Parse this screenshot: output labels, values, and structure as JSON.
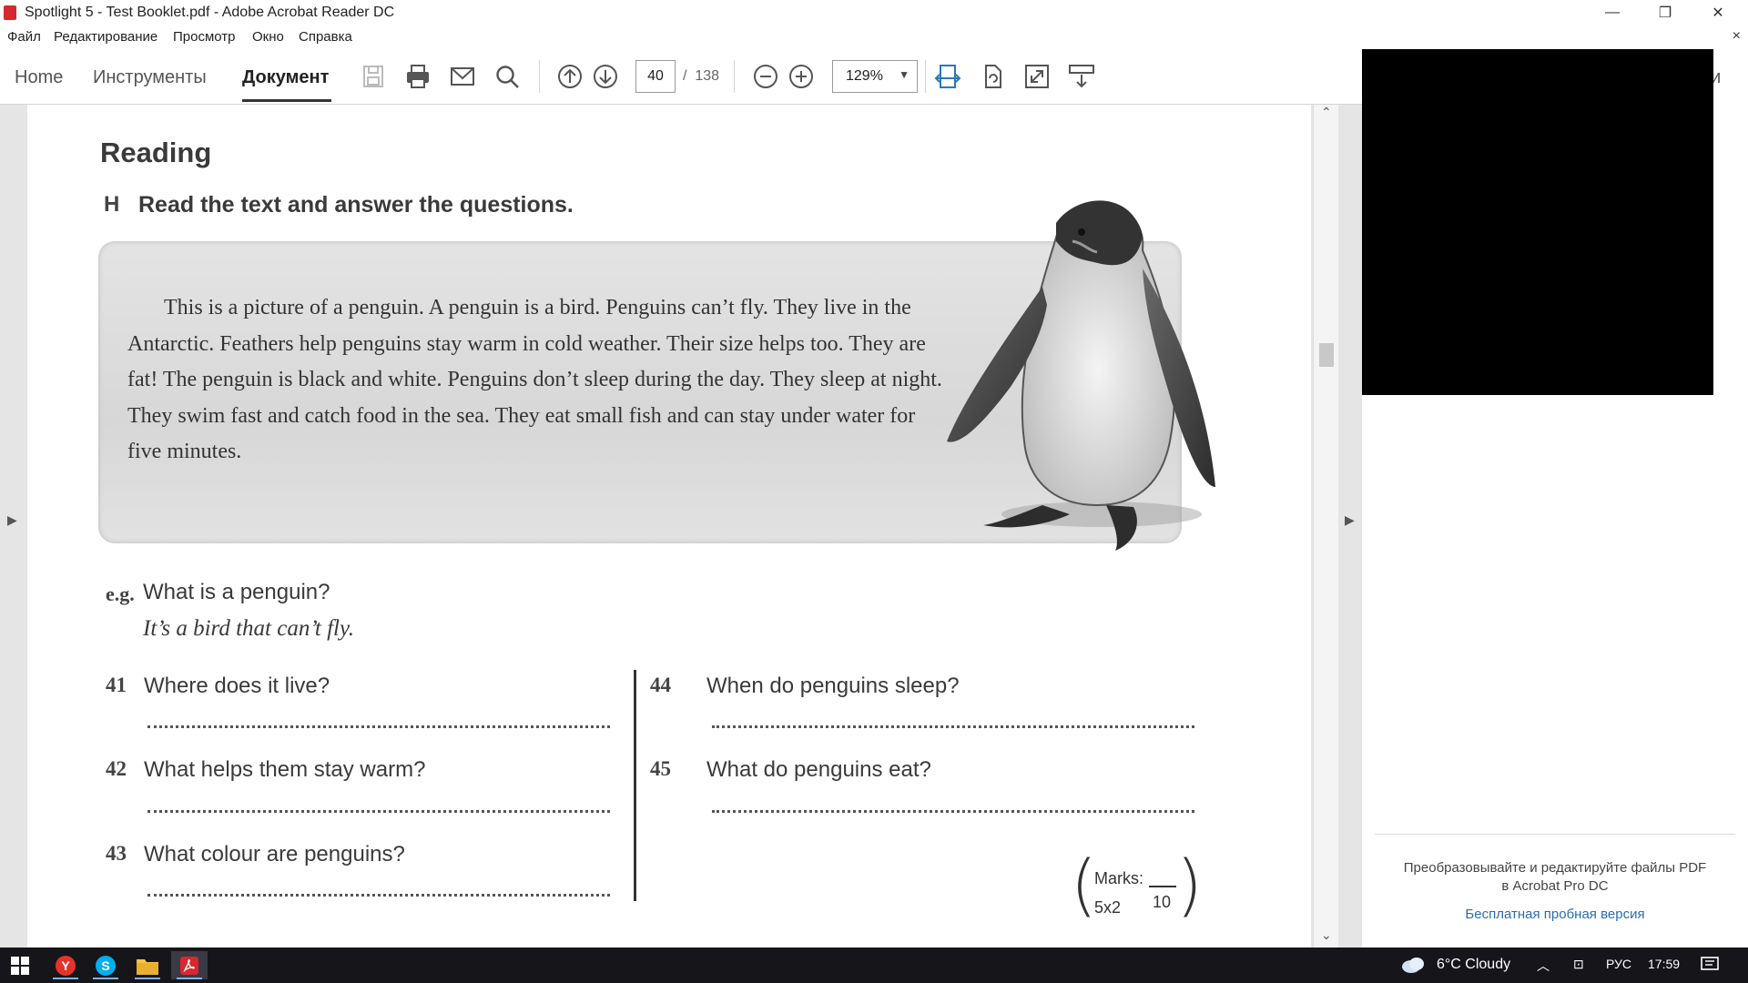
{
  "window": {
    "title": "Spotlight 5 - Test Booklet.pdf - Adobe Acrobat Reader DC",
    "minimize": "—",
    "maximize": "❐",
    "close": "✕"
  },
  "menu": {
    "items": [
      "Файл",
      "Редактирование",
      "Просмотр",
      "Окно",
      "Справка"
    ],
    "close": "×"
  },
  "toolbar": {
    "tabs": [
      "Home",
      "Инструменты",
      "Документ"
    ],
    "active_tab": "Документ",
    "page_current": "40",
    "page_separator": "/",
    "page_total": "138",
    "zoom": "129%",
    "icons": [
      "save-icon",
      "print-icon",
      "email-icon",
      "search-icon",
      "page-up-icon",
      "page-down-icon",
      "zoom-out-icon",
      "zoom-in-icon",
      "fit-width-icon",
      "rotate-icon",
      "fullscreen-icon",
      "read-mode-icon"
    ]
  },
  "right_panel": {
    "partial_label": "ти",
    "promo": "Преобразовывайте и редактируйте файлы PDF в Acrobat Pro DC",
    "promo_line1": "Преобразовывайте и редактируйте файлы PDF",
    "promo_line2": "в Acrobat Pro DC",
    "link": "Бесплатная пробная версия"
  },
  "document": {
    "section_title": "Reading",
    "task_letter": "H",
    "task_text": "Read the text and answer the questions.",
    "paragraph": "This is a picture of a penguin. A penguin is a bird. Penguins can’t fly. They live in the Antarctic. Feathers help penguins stay warm in cold weather. Their size helps too. They are fat! The penguin is black and white. Penguins don’t sleep during the day. They sleep at night. They swim fast and catch food in the sea. They eat small fish and can stay under water for five minutes.",
    "example": {
      "label": "e.g.",
      "question": "What is a penguin?",
      "answer": "It’s a bird that can’t fly."
    },
    "questions": [
      {
        "num": "41",
        "text": "Where does it live?"
      },
      {
        "num": "42",
        "text": "What helps them stay warm?"
      },
      {
        "num": "43",
        "text": "What colour are penguins?"
      },
      {
        "num": "44",
        "text": "When do penguins sleep?"
      },
      {
        "num": "45",
        "text": "What do penguins eat?"
      }
    ],
    "marks": {
      "label": "Marks:",
      "formula": "5x2",
      "total": "10"
    }
  },
  "taskbar": {
    "weather": "6°C  Cloudy",
    "language": "РУС",
    "time": "17:59"
  },
  "colors": {
    "acrobat_red": "#d7282f",
    "link_blue": "#2c6cb0",
    "taskbar": "#16161a"
  }
}
